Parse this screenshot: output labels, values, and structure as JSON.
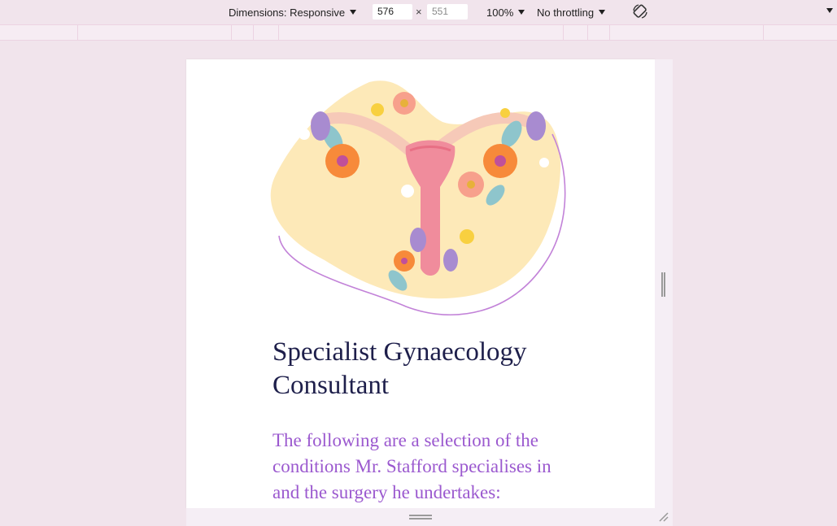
{
  "toolbar": {
    "dimensions_label": "Dimensions: Responsive",
    "width_value": "576",
    "times_symbol": "×",
    "height_placeholder": "551",
    "zoom_label": "100%",
    "throttling_label": "No throttling",
    "rotate_icon": "rotate-icon",
    "more_icon": "chevron-down-icon"
  },
  "page": {
    "heading": "Specialist Gynaecology Consultant",
    "lead": "The following are a selection of the conditions Mr. Stafford specialises in and the surgery he undertakes:"
  },
  "colors": {
    "heading": "#1e1f4b",
    "lead": "#9b59cf",
    "blob": "#fde9b8",
    "uterus": "#f08c9c",
    "outline": "#c282d8"
  }
}
